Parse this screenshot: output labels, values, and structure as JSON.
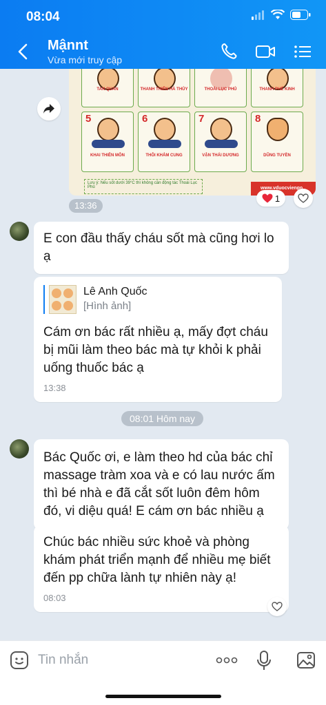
{
  "status_bar": {
    "time": "08:04"
  },
  "header": {
    "title": "Mậnnt",
    "subtitle": "Vừa mới truy cập"
  },
  "image_message": {
    "time": "13:36",
    "reaction_count": "1",
    "cells": [
      {
        "number": "",
        "label": "TAN QUAN"
      },
      {
        "number": "",
        "label": "THANH THIÊN HÀ THỦY"
      },
      {
        "number": "",
        "label": "THOÁI LỤC PHỦ"
      },
      {
        "number": "",
        "label": "THANH PHẾ KINH"
      },
      {
        "number": "5",
        "label": "KHAI THIÊN MÔN"
      },
      {
        "number": "6",
        "label": "THÔI KHẢM CUNG"
      },
      {
        "number": "7",
        "label": "VẬN THÁI DƯƠNG"
      },
      {
        "number": "8",
        "label": "DŨNG TUYỀN"
      }
    ],
    "footnote": "Lưu ý: Nếu sốt dưới 39°C thì không cần động tác Thoái Lục Phủ",
    "brand": "www.vduocviengo"
  },
  "messages": [
    {
      "text": "E con đầu thấy cháu sốt mà cũng hơi lo ạ"
    },
    {
      "quote_name": "Lê Anh Quốc",
      "quote_text": "[Hình ảnh]",
      "text": "Cám ơn bác rất nhiều ạ, mấy đợt cháu bị mũi làm theo bác mà tự khỏi k phải uống thuốc bác ạ",
      "time": "13:38"
    },
    {
      "text": "Bác Quốc ơi, e làm theo hd của bác chỉ massage tràm xoa và e có lau nước ấm thì bé nhà e đã cắt sốt luôn đêm hôm đó, vi diệu quá! E cám ơn bác nhiều ạ"
    },
    {
      "text": "Chúc bác nhiều sức khoẻ và phòng khám phát triển mạnh để nhiều mẹ biết đến pp chữa lành tự nhiên này ạ!",
      "time": "08:03"
    }
  ],
  "date_separator": "08:01 Hôm nay",
  "input": {
    "placeholder": "Tin nhắn"
  },
  "colors": {
    "header": "#0b7cf2",
    "background": "#e2e9f1",
    "accent": "#0b7cf2"
  }
}
